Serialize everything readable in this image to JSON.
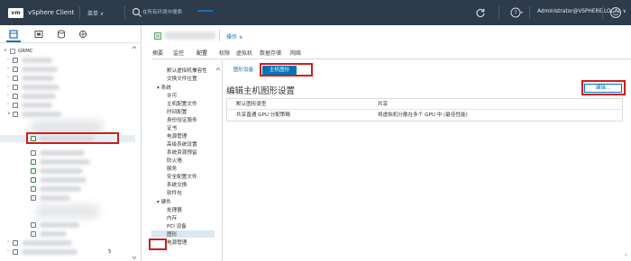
{
  "topbar": {
    "logo": "vm",
    "app_name": "vSphere Client",
    "menu_label": "菜单 ∨",
    "search_placeholder": "在所有环境中搜索",
    "user_label": "Administrator@VSPHERE.LOCAL ∨",
    "icons": [
      "search-icon",
      "refresh-icon",
      "help-icon",
      "smile-icon"
    ]
  },
  "tree": {
    "root_label": "GRMC",
    "page_number": "5"
  },
  "header": {
    "actions_label": "操作 ∨"
  },
  "main_tabs": [
    "摘要",
    "监控",
    "配置",
    "权限",
    "虚拟机",
    "数据存储",
    "网络"
  ],
  "active_main_tab": "配置",
  "config_nav": {
    "items_top": [
      "默认虚拟机兼容性",
      "交换文件位置"
    ],
    "system_group": "系统",
    "system_items": [
      "许可",
      "主机配置文件",
      "时间配置",
      "身份验证服务",
      "证书",
      "电源管理",
      "高级系统设置",
      "系统资源预留",
      "防火墙",
      "服务",
      "安全配置文件",
      "系统交换",
      "软件包"
    ],
    "hardware_group": "硬件",
    "hardware_items": [
      "处理器",
      "内存",
      "PCI 设备",
      "图形",
      "电源管理"
    ],
    "selected_item": "图形"
  },
  "graphics": {
    "subtabs": [
      "图形设备",
      "主机图形"
    ],
    "active_subtab": "主机图形",
    "section_title": "编辑主机图形设置",
    "edit_button": "编辑...",
    "settings": [
      {
        "key": "默认图形类型",
        "value": "共享"
      },
      {
        "key": "共享直通 GPU 分配策略",
        "value": "将虚拟机分散在多个 GPU 中 (最佳性能)"
      }
    ]
  },
  "colors": {
    "topbar_bg": "#2d3b4a",
    "accent": "#0073b7",
    "highlight_box": "#d21b1b",
    "selected_nav_bg": "#dbe7f1"
  }
}
